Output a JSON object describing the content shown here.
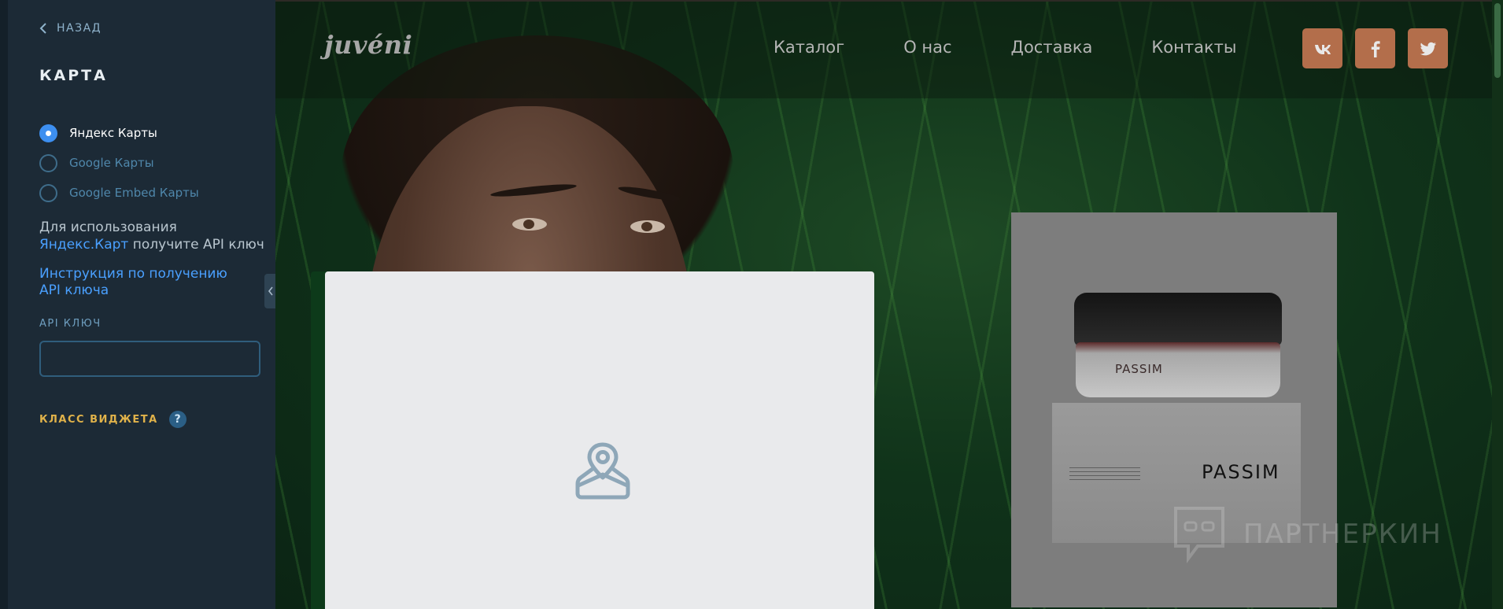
{
  "panel": {
    "back_label": "НАЗАД",
    "title": "КАРТА",
    "map_options": [
      {
        "label": "Яндекс Карты",
        "selected": true
      },
      {
        "label": "Google Карты",
        "selected": false
      },
      {
        "label": "Google Embed Карты",
        "selected": false
      }
    ],
    "info_prefix": "Для использования ",
    "info_link": "Яндекс.Карт",
    "info_suffix": " получите API ключ",
    "instruction_link": "Инструкция по получению API ключа",
    "api_key_label": "API КЛЮЧ",
    "api_key_value": "",
    "widget_class_label": "КЛАСС ВИДЖЕТА",
    "help_symbol": "?"
  },
  "site": {
    "logo": "juvéni",
    "nav": [
      "Каталог",
      "О нас",
      "Доставка",
      "Контакты"
    ],
    "socials": [
      "vk-icon",
      "facebook-icon",
      "twitter-icon"
    ],
    "social_color": "#b36e4b",
    "product_jar_brand": "PASSIM",
    "product_box_brand": "PASSIM",
    "watermark": "ПАРТНЕРКИН"
  },
  "colors": {
    "accent": "#3d8ff0",
    "link": "#4aa0ff",
    "widget_label": "#e0b24a"
  }
}
